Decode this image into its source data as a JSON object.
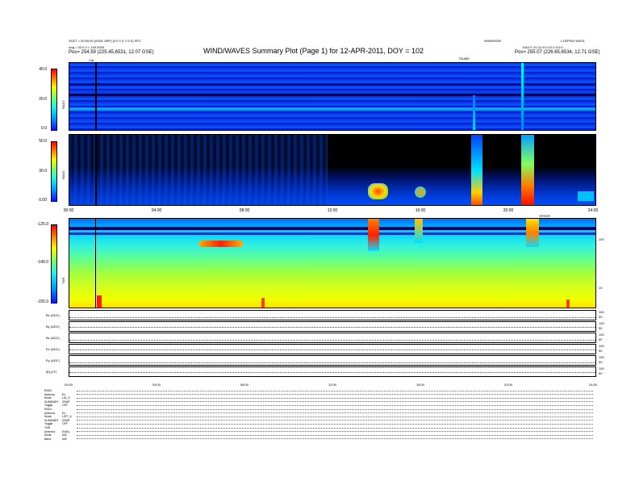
{
  "header": {
    "title": "WIND/WAVES Summary Plot (Page 1) for 12-APR-2011, DOY = 102",
    "left_line1": "SCET = 00:00:00 (0000; 0RP) (0 0 0 0; 0 0 0) SPC",
    "left_line2": "Ang = 02:0 3 = 100 0000",
    "left_pos": "Pos= 254.59 (225.45,6531, 12.07 GSE)",
    "center_right": "WIN000000",
    "right_line1": "L1/EP000 b0001",
    "right_line2": "DAILY: 01:11:0:0 0:0:1:0:0:0",
    "right_pos": "Pos= 255.07 (226.65,6534, 12.71 GSE)",
    "tick_label": "TSUME",
    "cal_marker": "Cal"
  },
  "panels": {
    "rad2": {
      "label": "RAD2",
      "ticks": [
        "40.0",
        "20.0",
        "0.0"
      ]
    },
    "rad1": {
      "label": "RAD1",
      "ticks": [
        "50.0",
        "30.0",
        "0.00"
      ]
    },
    "tnr": {
      "label": "TNR",
      "ticks": [
        "-125.0",
        "-140.0",
        "-155.0"
      ],
      "right_ticks": [
        "100",
        "10"
      ],
      "side_label": "SPHER"
    },
    "x_labels": [
      "00:00",
      "04:00",
      "08:00",
      "12:00",
      "16:00",
      "20:00",
      "24:00"
    ],
    "line_panels": [
      {
        "label": "Bx (ADC)",
        "right": [
          "100",
          "50"
        ]
      },
      {
        "label": "By (ADC)",
        "right": [
          "100",
          "50"
        ]
      },
      {
        "label": "Bz (ADC)",
        "right": [
          "100",
          "50"
        ]
      },
      {
        "label": "Ex (ADC)",
        "right": [
          "100",
          "50"
        ]
      },
      {
        "label": "Ey (ADC)",
        "right": [
          "100",
          "50"
        ]
      },
      {
        "label": "|B| (nT)",
        "right": [
          "100",
          "50"
        ]
      }
    ],
    "bottom_x_labels": [
      "00:00",
      "04:00",
      "08:00",
      "12:00",
      "16:00",
      "20:00",
      "24:00"
    ]
  },
  "status": [
    {
      "k": "RAD2",
      "v": ""
    },
    {
      "k": "Antenna",
      "v": "Ex"
    },
    {
      "k": "Mode",
      "v": "LIN_S"
    },
    {
      "k": "SUMMARY",
      "v": "ZSMP"
    },
    {
      "k": "Toggle",
      "v": "OFF"
    },
    {
      "k": "RAD1",
      "v": ""
    },
    {
      "k": "Antenna",
      "v": "Ex"
    },
    {
      "k": "Mode",
      "v": "LIST_A"
    },
    {
      "k": "SUMMARY",
      "v": "ZSMP"
    },
    {
      "k": "Toggle",
      "v": "OFF"
    },
    {
      "k": "TNR",
      "v": ""
    },
    {
      "k": "Antenna",
      "v": "Ex/Ey"
    },
    {
      "k": "Mode",
      "v": "A/B"
    },
    {
      "k": "Band",
      "v": "A/B"
    }
  ],
  "colors": {
    "background": "#000000",
    "low": "#1010ff",
    "high": "#ff0000"
  }
}
